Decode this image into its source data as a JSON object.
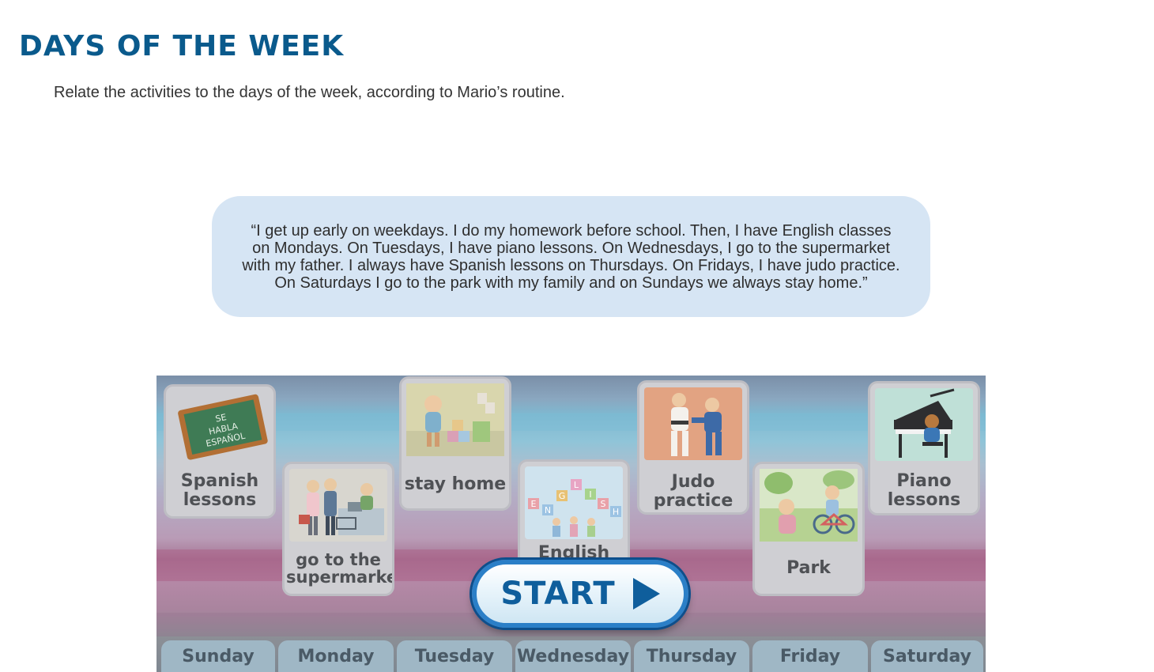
{
  "header": {
    "title": "DAYS OF THE WEEK",
    "instructions": "Relate the activities to the days of the week, according to Mario’s routine."
  },
  "quote": {
    "text": "“I get up early on weekdays. I do my homework before school. Then, I have English classes on Mondays. On Tuesdays, I have piano lessons. On Wednesdays, I go to the supermarket with my father. I always have Spanish lessons on Thursdays. On Fridays, I have judo practice. On Saturdays I go to the park with my family and on Sundays we always stay home.”"
  },
  "game": {
    "cards": [
      {
        "label": "Spanish lessons",
        "icon": "chalkboard-icon"
      },
      {
        "label": "go to the supermarket",
        "icon": "supermarket-icon"
      },
      {
        "label": "stay home",
        "icon": "toy-blocks-icon"
      },
      {
        "label": "English",
        "icon": "english-letters-icon"
      },
      {
        "label": "Judo practice",
        "icon": "judo-icon"
      },
      {
        "label": "Park",
        "icon": "park-bicycle-icon"
      },
      {
        "label": "Piano lessons",
        "icon": "piano-icon"
      }
    ],
    "days": [
      "Sunday",
      "Monday",
      "Tuesday",
      "Wednesday",
      "Thursday",
      "Friday",
      "Saturday"
    ],
    "start_label": "START",
    "start_icon": "play-arrow-icon",
    "accent": "#0f5e9c"
  }
}
